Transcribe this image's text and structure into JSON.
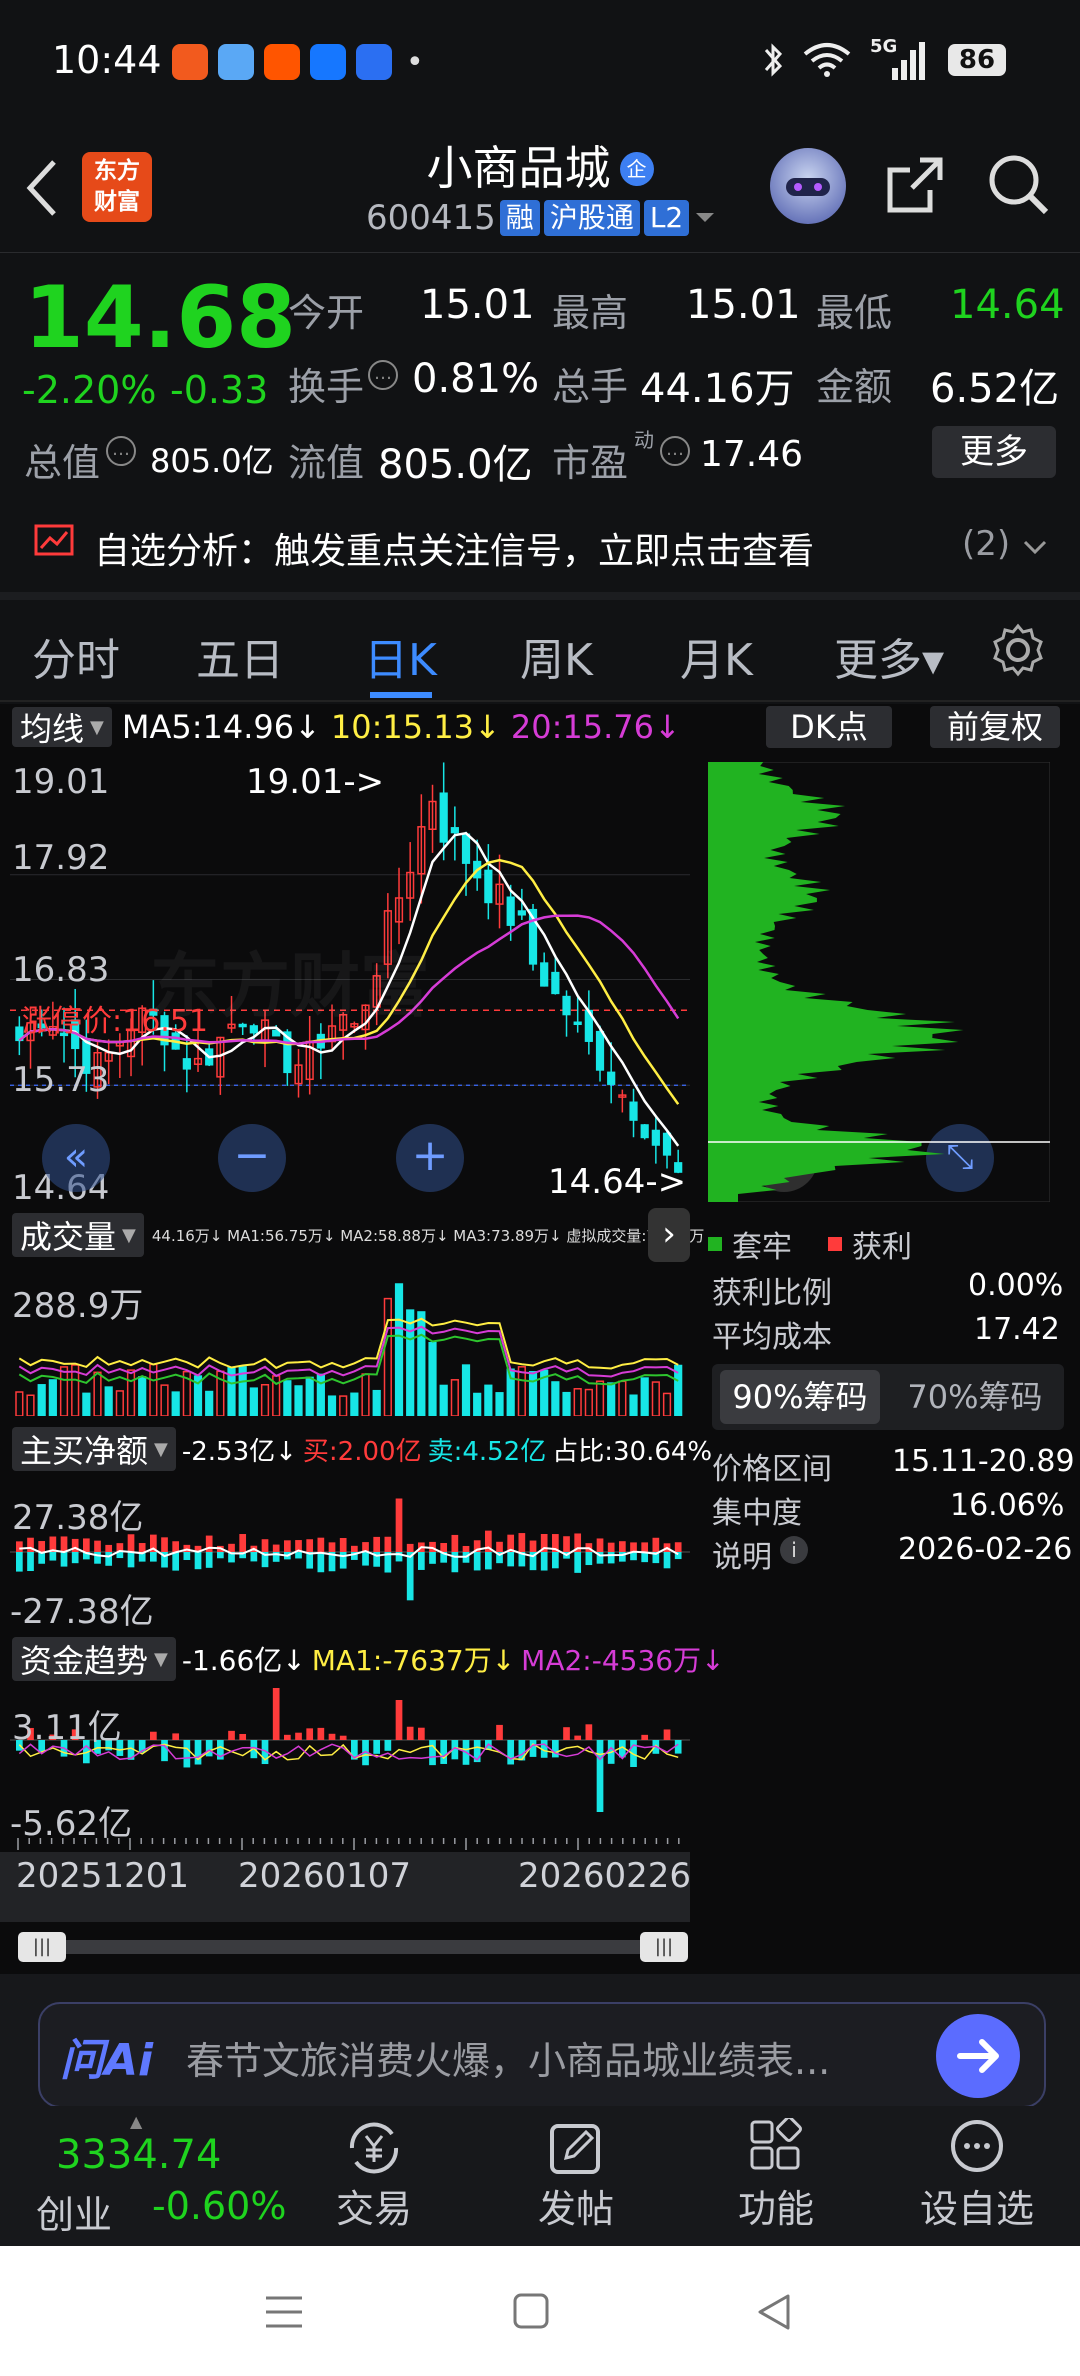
{
  "status_bar": {
    "time": "10:44",
    "battery": "86",
    "network": "5G",
    "dot": "•"
  },
  "header": {
    "brand_line1": "东方",
    "brand_line2": "财富",
    "title": "小商品城",
    "title_badge": "企",
    "code": "600415",
    "tag_margin": "融",
    "tag_connect": "沪股通",
    "tag_level": "L2"
  },
  "quote": {
    "price": "14.68",
    "change_pct": "-2.20%",
    "change_amt": "-0.33",
    "open_label": "今开",
    "open": "15.01",
    "high_label": "最高",
    "high": "15.01",
    "low_label": "最低",
    "low": "14.64",
    "turnover_label": "换手",
    "turnover": "0.81%",
    "volume_label": "总手",
    "volume": "44.16万",
    "amount_label": "金额",
    "amount": "6.52亿",
    "mktcap_label": "总值",
    "mktcap": "805.0亿",
    "float_label": "流值",
    "float": "805.0亿",
    "pe_label": "市盈",
    "pe_sup": "动",
    "pe": "17.46",
    "more_label": "更多"
  },
  "notice": {
    "text": "自选分析：触发重点关注信号，立即点击查看",
    "count": "(2)"
  },
  "tabs": [
    "分时",
    "五日",
    "日K",
    "周K",
    "月K",
    "更多▾"
  ],
  "active_tab": 2,
  "kline": {
    "indicator_label": "均线",
    "ma5": "MA5:14.96↓",
    "ma10": "10:15.13↓",
    "ma20": "20:15.76↓",
    "dk_label": "DK点",
    "restore_label": "前复权",
    "y_ticks": [
      "19.01",
      "17.92",
      "16.83",
      "15.73",
      "14.64"
    ],
    "max_label": "19.01->",
    "min_label": "14.64->",
    "limit_label": "涨停价:16.51",
    "watermark": "东方财富"
  },
  "volume_panel": {
    "label": "成交量",
    "info": "44.16万↓ MA1:56.75万↓ MA2:58.88万↓ MA3:73.89万↓ 虚拟成交量:70.05万",
    "top_tick": "288.9万"
  },
  "netbuy_panel": {
    "label": "主买净额",
    "info_val": "-2.53亿↓",
    "info_buy": "买:2.00亿",
    "info_sell": "卖:4.52亿",
    "info_ratio": "占比:30.64%",
    "top": "27.38亿",
    "bottom": "-27.38亿"
  },
  "fund_panel": {
    "label": "资金趋势",
    "info_val": "-1.66亿↓",
    "ma1": "MA1:-7637万↓",
    "ma2": "MA2:-4536万↓",
    "top": "3.11亿",
    "bottom": "-5.62亿"
  },
  "dates": [
    "20251201",
    "20260107",
    "20260226"
  ],
  "chip": {
    "legend_trapped": "套牢",
    "legend_profit": "获利",
    "profit_ratio_label": "获利比例",
    "profit_ratio": "0.00%",
    "avg_cost_label": "平均成本",
    "avg_cost": "17.42",
    "tab90": "90%筹码",
    "tab70": "70%筹码",
    "range_label": "价格区间",
    "range": "15.11-20.89",
    "concentration_label": "集中度",
    "concentration": "16.06%",
    "note_label": "说明",
    "note_date": "2026-02-26"
  },
  "ai_bar": {
    "logo": "问Ai",
    "placeholder": "春节文旅消费火爆，小商品城业绩表..."
  },
  "bottom_nav": {
    "index_value": "3334.74",
    "index_name": "创业",
    "index_change": "-0.60%",
    "trade": "交易",
    "post": "发帖",
    "function": "功能",
    "add_watch": "设自选"
  },
  "colors": {
    "up": "#ff3b3b",
    "down": "#17e6e6",
    "ma5": "#ffffff",
    "ma10": "#ffee44",
    "ma20": "#d63cd6",
    "accent": "#3d8bff",
    "chip": "#21b321"
  }
}
